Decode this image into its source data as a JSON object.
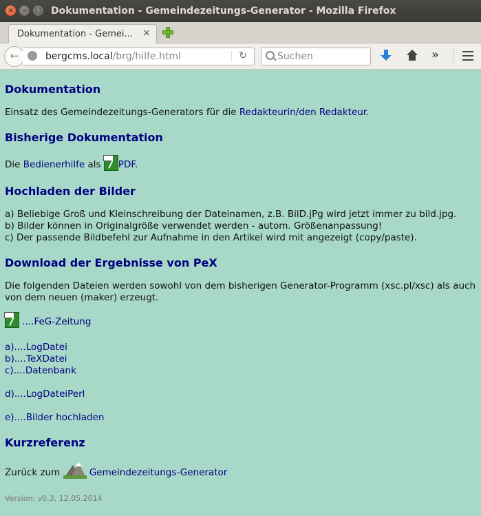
{
  "window": {
    "title": "Dokumentation - Gemeindezeitungs-Generator - Mozilla Firefox"
  },
  "tab": {
    "title": "Dokumentation - Gemei...",
    "close": "×"
  },
  "nav": {
    "url_host": "bergcms.local",
    "url_path": "/brg/hilfe.html",
    "search_placeholder": "Suchen",
    "overflow": "»"
  },
  "page": {
    "h_doc": "Dokumentation",
    "intro_text": "Einsatz des Gemeindezeitungs-Generators für die ",
    "intro_link": "Redakteurin/den Redakteur",
    "intro_end": ".",
    "h_prev": "Bisherige Dokumentation",
    "prev_text1": "Die ",
    "prev_link1": "Bedienerhilfe",
    "prev_text2": " als ",
    "prev_link2": "PDF",
    "prev_end": ".",
    "h_upload": "Hochladen der Bilder",
    "upload_a": "a) Beliebige Groß und Kleinschreibung der Dateinamen, z.B. BilD.jPg wird jetzt immer zu bild.jpg.",
    "upload_b": "b) Bilder können in Originalgröße verwendet werden - autom. Größenanpassung!",
    "upload_c": "c) Der passende Bildbefehl zur Aufnahme in den Artikel wird mit angezeigt (copy/paste).",
    "h_download": "Download der Ergebnisse von PeX",
    "download_line1": "Die folgenden Dateien werden sowohl von dem bisherigen Generator-Programm (xsc.pl/xsc) als auch",
    "download_line2": "von dem neuen (maker) erzeugt.",
    "feg_link": "....FeG-Zeitung",
    "link_a": "a)....LogDatei",
    "link_b": "b)....TeXDatei",
    "link_c": "c)....Datenbank",
    "link_d": "d)....LogDateiPerl",
    "link_e": "e)....Bilder hochladen",
    "h_ref": "Kurzreferenz",
    "back_text": "Zurück zum ",
    "back_link": "Gemeindezeitungs-Generator",
    "version": "Version: v0.3, 12.05.2014"
  }
}
